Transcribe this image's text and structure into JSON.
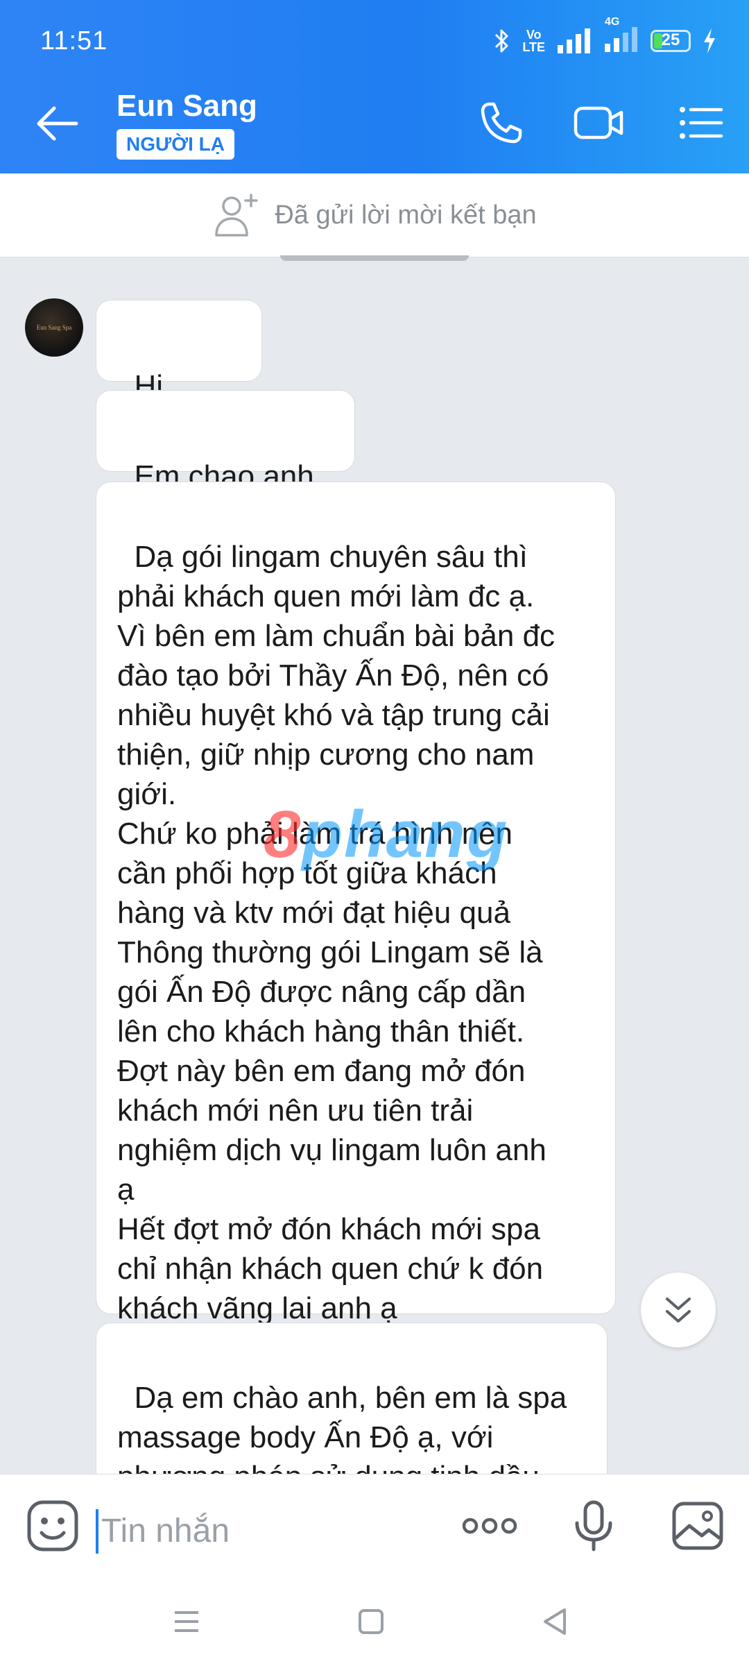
{
  "status_bar": {
    "time": "11:51",
    "network_label_top": "Vo",
    "network_label_bottom": "LTE",
    "network_type": "4G",
    "battery_level": "25",
    "icons": [
      "bluetooth-icon",
      "signal-icon",
      "battery-icon",
      "charging-icon"
    ]
  },
  "header": {
    "contact_name": "Eun Sang",
    "badge": "NGƯỜI LẠ",
    "icons": [
      "back-arrow-icon",
      "phone-icon",
      "video-call-icon",
      "menu-icon"
    ],
    "color": "#1f7ef2"
  },
  "friend_bar": {
    "text": "Đã gửi lời mời kết bạn",
    "icon": "add-friend-icon"
  },
  "avatar": {
    "text": "Eun Sang Spa"
  },
  "messages": [
    {
      "text": "Hi"
    },
    {
      "text": "Em chao anh p"
    },
    {
      "text": "Dạ gói lingam chuyên sâu thì\nphải khách quen mới làm đc ạ.\nVì bên em làm chuẩn bài bản đc\nđào tạo bởi Thầy Ấn Độ, nên có\nnhiều huyệt khó và tập trung cải\nthiện, giữ nhịp cương cho nam\ngiới.\nChứ ko phải làm trá hình nên\ncần phối hợp tốt giữa khách\nhàng và ktv mới đạt hiệu quả\nThông thường gói Lingam sẽ là\ngói Ấn Độ được nâng cấp dần\nlên cho khách hàng thân thiết.\nĐợt này bên em đang mở đón\nkhách mới nên ưu tiên trải\nnghiệm dịch vụ lingam luôn anh\nạ\nHết đợt mở đón khách mới spa\nchỉ nhận khách quen chứ k đón\nkhách vãng lai anh ạ"
    },
    {
      "text": "Dạ em chào anh, bên em là spa\nmassage body Ấn Độ ạ, với\nphương pháp sử dụng tinh dầu\nnóng và đá nóng để giúp"
    }
  ],
  "watermark": {
    "prefix": "8",
    "text": "phang"
  },
  "composer": {
    "placeholder": "Tin nhắn",
    "icons": [
      "emoji-icon",
      "more-icon",
      "microphone-icon",
      "image-icon"
    ]
  },
  "nav_bar": {
    "icons": [
      "recent-apps-icon",
      "home-icon",
      "back-icon"
    ]
  }
}
